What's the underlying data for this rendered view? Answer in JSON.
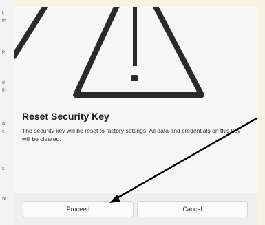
{
  "dialog": {
    "title": "Reset Security Key",
    "message": "The security key will be reset to factory settings. All data and credentials on this key will be cleared.",
    "icon": "warning-icon",
    "buttons": {
      "proceed": "Proceed",
      "cancel": "Cancel"
    }
  },
  "background_window": {
    "fragments": [
      "k",
      "th",
      "p",
      "d",
      "th",
      "a",
      "e",
      "s",
      "w"
    ]
  },
  "colors": {
    "page_background": "#f8f1e6",
    "dialog_background": "#f7f7f7",
    "footer_background": "#efefef",
    "annotation_arrow": "#000000"
  }
}
